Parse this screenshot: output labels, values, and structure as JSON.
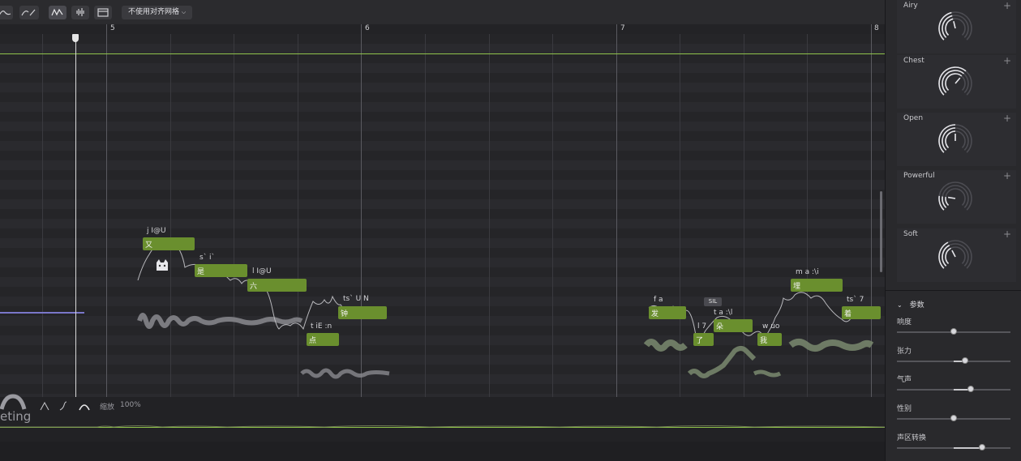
{
  "toolbar": {
    "grid_select": "不使用对齐网格"
  },
  "ruler": {
    "bars": [
      "5",
      "6",
      "7",
      "8"
    ]
  },
  "notes": [
    {
      "lyric": "又",
      "phoneme": "j I@U"
    },
    {
      "lyric": "是",
      "phoneme": "s` i`"
    },
    {
      "lyric": "六",
      "phoneme": "l I@U"
    },
    {
      "lyric": "点",
      "phoneme": "t iE :n"
    },
    {
      "lyric": "钟",
      "phoneme": "ts` U N"
    },
    {
      "lyric": "发",
      "phoneme": "f a"
    },
    {
      "lyric": "了",
      "phoneme": "l 7"
    },
    {
      "lyric": "朵",
      "phoneme": "t a :\\l"
    },
    {
      "lyric": "我",
      "phoneme": "w uo"
    },
    {
      "lyric": "埋",
      "phoneme": "m a :\\i"
    },
    {
      "lyric": "着",
      "phoneme": "ts` 7"
    }
  ],
  "sil_badge": "SIL",
  "bottom": {
    "zoom_label": "缩放",
    "zoom_value": "100%",
    "logo_text": "eting",
    "add": "+"
  },
  "styles": [
    {
      "name": "Airy",
      "level": 0.45
    },
    {
      "name": "Chest",
      "level": 0.65
    },
    {
      "name": "Open",
      "level": 0.5
    },
    {
      "name": "Powerful",
      "level": 0.2
    },
    {
      "name": "Soft",
      "level": 0.4
    }
  ],
  "params": {
    "header": "参数",
    "items": [
      {
        "label": "响度",
        "value": 0.5
      },
      {
        "label": "张力",
        "value": 0.6
      },
      {
        "label": "气声",
        "value": 0.65
      },
      {
        "label": "性别",
        "value": 0.5
      },
      {
        "label": "声区转换",
        "value": 0.75
      }
    ]
  },
  "colors": {
    "note": "#6a8f2e",
    "accent_green": "#8fc34a",
    "playhead": "#d8d8d8"
  }
}
